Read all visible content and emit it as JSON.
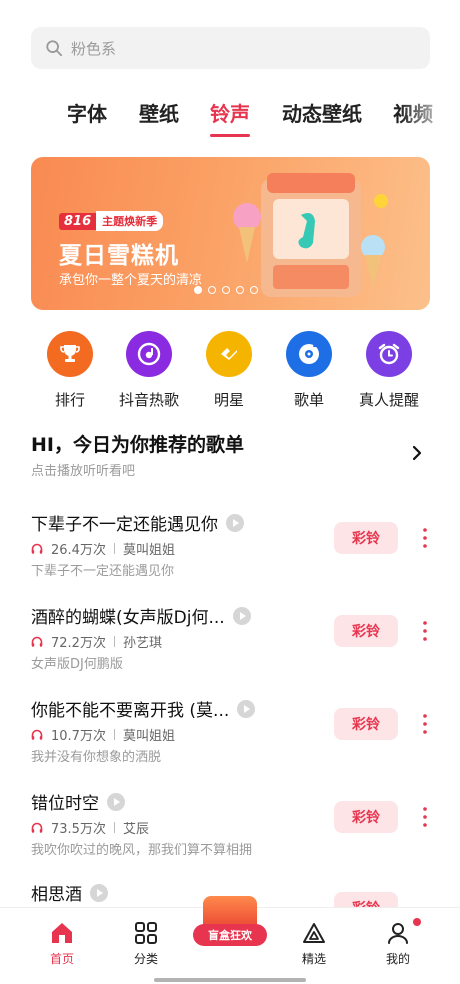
{
  "search": {
    "placeholder": "粉色系",
    "icon": "search-icon"
  },
  "tabs": [
    {
      "label": "字体"
    },
    {
      "label": "壁纸"
    },
    {
      "label": "铃声",
      "active": true
    },
    {
      "label": "动态壁纸"
    },
    {
      "label": "视频"
    }
  ],
  "banner": {
    "badge_num": "816",
    "badge_text": "主题焕新季",
    "title": "夏日雪糕机",
    "subtitle": "承包你一整个夏天的清凉",
    "slides": 5,
    "current_slide": 1
  },
  "categories": [
    {
      "label": "排行",
      "icon": "trophy-icon",
      "color": "#f26b21"
    },
    {
      "label": "抖音热歌",
      "icon": "music-disc-icon",
      "color": "#8a2be2"
    },
    {
      "label": "明星",
      "icon": "star-diamond-icon",
      "color": "#f5b400"
    },
    {
      "label": "歌单",
      "icon": "playlist-disc-icon",
      "color": "#1e6fe6"
    },
    {
      "label": "真人提醒",
      "icon": "alarm-clock-icon",
      "color": "#7b3fe4"
    }
  ],
  "recommend": {
    "title": "HI，今日为你推荐的歌单",
    "subtitle": "点击播放听听看吧"
  },
  "songs": [
    {
      "name": "下辈子不一定还能遇见你",
      "plays": "26.4万次",
      "artist": "莫叫姐姐",
      "desc": "下辈子不一定还能遇见你",
      "button": "彩铃"
    },
    {
      "name": "酒醉的蝴蝶(女声版Dj何...",
      "plays": "72.2万次",
      "artist": "孙艺琪",
      "desc": "女声版DJ何鹏版",
      "button": "彩铃"
    },
    {
      "name": "你能不能不要离开我 (莫...",
      "plays": "10.7万次",
      "artist": "莫叫姐姐",
      "desc": "我并没有你想象的洒脱",
      "button": "彩铃"
    },
    {
      "name": "错位时空",
      "plays": "73.5万次",
      "artist": "艾辰",
      "desc": "我吹你吹过的晚风，那我们算不算相拥",
      "button": "彩铃"
    },
    {
      "name": "相思酒",
      "plays": "",
      "artist": "",
      "desc": "",
      "button": "彩铃"
    }
  ],
  "bottom_nav": [
    {
      "label": "首页",
      "icon": "home-icon",
      "active": true
    },
    {
      "label": "分类",
      "icon": "grid-icon"
    },
    {
      "label": "盲盒狂欢",
      "icon": "blind-box-icon"
    },
    {
      "label": "精选",
      "icon": "triangle-icon"
    },
    {
      "label": "我的",
      "icon": "user-icon",
      "notification_dot": true
    }
  ],
  "colors": {
    "accent": "#e8354f",
    "ring_button_bg": "#fde4e7"
  }
}
